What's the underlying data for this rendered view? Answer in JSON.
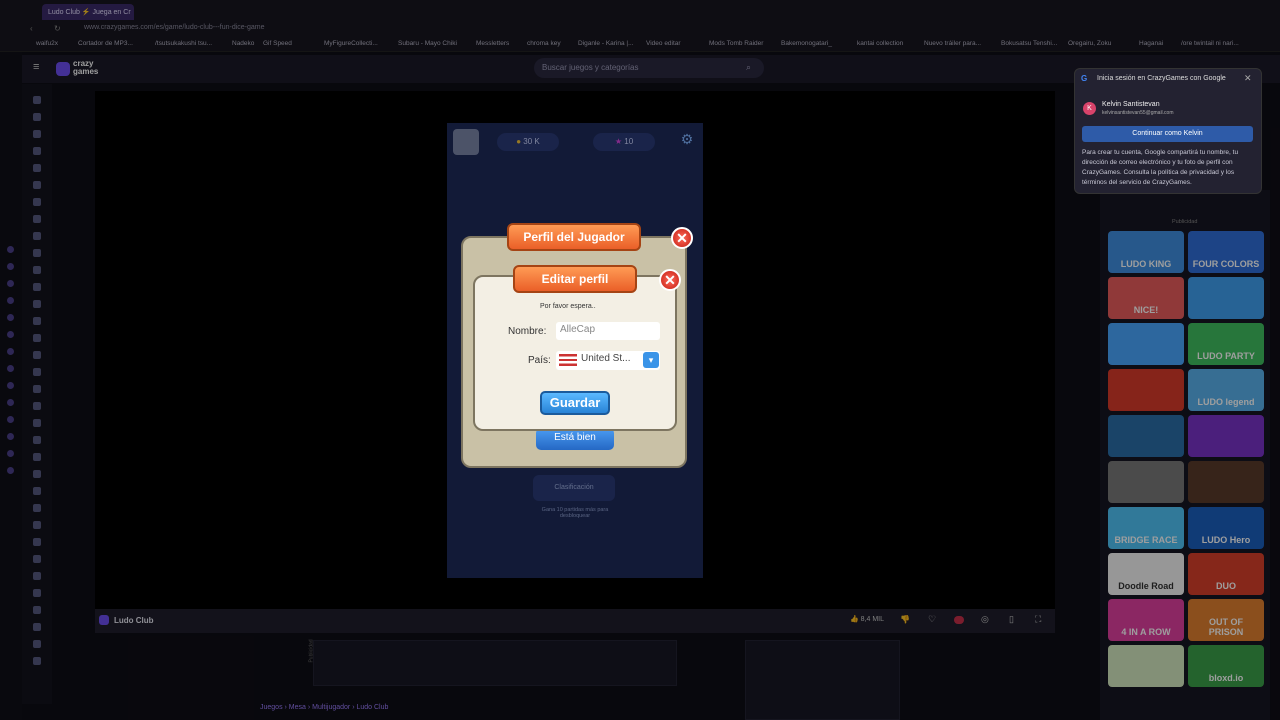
{
  "browser": {
    "tab_title": "Ludo Club ⚡ Juega en Cr",
    "url": "www.crazygames.com/es/game/ludo-club---fun-dice-game",
    "bookmarks": [
      "waifu2x",
      "Cortador de MP3...",
      "/tsutsukakushi tsu...",
      "Nadeko",
      "Gif Speed",
      "MyFigureCollecti...",
      "Subaru - Mayo Chiki",
      "Messletters",
      "chroma key",
      "Diganle - Karina |...",
      "Video editar",
      "Mods Tomb Raider",
      "Bakemonogatari_",
      "kantai collection",
      "Nuevo tráiler para...",
      "Bokusatsu Tenshi...",
      "Oregairu, Zoku",
      "Haganai",
      "/ore twintail ni nari..."
    ]
  },
  "site": {
    "logo_line1": "crazy",
    "logo_line2": "games",
    "search_placeholder": "Buscar juegos y categorías",
    "game_title": "Ludo Club",
    "likes": "8,4 MIL",
    "breadcrumb": "Juegos › Mesa › Multijugador › Ludo Club",
    "ads_label": "Publicidad"
  },
  "game_hud": {
    "coins": "30 K",
    "gems": "10"
  },
  "dialog": {
    "profile_title": "Perfil del Jugador",
    "edit_title": "Editar perfil",
    "wait_text": "Por favor espera..",
    "name_label": "Nombre:",
    "name_value": "AlleCap",
    "country_label": "País:",
    "country_value": "United St...",
    "save_label": "Guardar",
    "ok_label": "Está bien",
    "leaderboard_label": "Clasificación",
    "leaderboard_hint": "Gana 10 partidas más para desbloquear"
  },
  "google_popup": {
    "title": "Inicia sesión en CrazyGames con Google",
    "user_name": "Kelvin Santistevan",
    "user_email": "kelvinsantistevan55@gmail.com",
    "continue_label": "Continuar como Kelvin",
    "info": "Para crear tu cuenta, Google compartirá tu nombre, tu dirección de correo electrónico y tu foto de perfil con CrazyGames. Consulta la política de privacidad y los términos del servicio de CrazyGames."
  },
  "sidebar_games": [
    {
      "label": "LUDO KING",
      "color": "#3f8fe0"
    },
    {
      "label": "FOUR COLORS",
      "color": "#2f6fd8"
    },
    {
      "label": "NICE!",
      "color": "#e85c5c"
    },
    {
      "label": "",
      "color": "#3fa0f0"
    },
    {
      "label": "",
      "color": "#4aa6ff"
    },
    {
      "label": "LUDO PARTY",
      "color": "#3fbf5f"
    },
    {
      "label": "",
      "color": "#d83a2a"
    },
    {
      "label": "LUDO legend",
      "color": "#5ab2ee"
    },
    {
      "label": "",
      "color": "#2a6fa8"
    },
    {
      "label": "",
      "color": "#7a32c8"
    },
    {
      "label": "",
      "color": "#7a7a7a"
    },
    {
      "label": "",
      "color": "#5a3a2a"
    },
    {
      "label": "BRIDGE RACE",
      "color": "#4fc3f7"
    },
    {
      "label": "LUDO Hero",
      "color": "#1b5fbf"
    },
    {
      "label": "Doodle Road",
      "color": "#f4f4f4"
    },
    {
      "label": "DUO",
      "color": "#d8402a"
    },
    {
      "label": "4 IN A ROW",
      "color": "#e040a0"
    },
    {
      "label": "OUT OF PRISON",
      "color": "#e08030"
    },
    {
      "label": "",
      "color": "#d4e8c0"
    },
    {
      "label": "bloxd.io",
      "color": "#3aa04a"
    }
  ]
}
